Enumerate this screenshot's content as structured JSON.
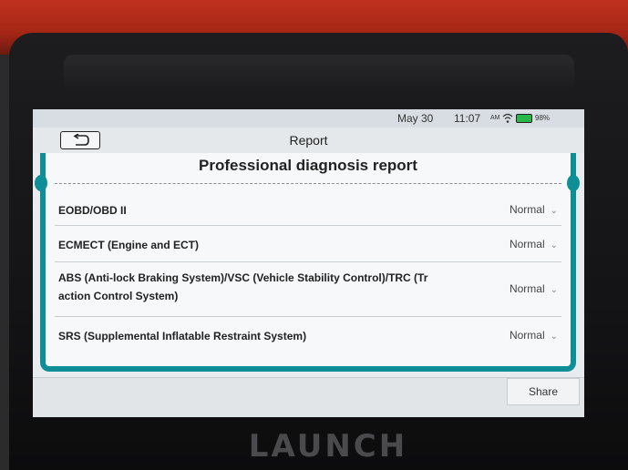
{
  "status_bar": {
    "date": "May 30",
    "time": "11:07",
    "ampm": "AM",
    "battery": "98%"
  },
  "header": {
    "title": "Report",
    "back_icon": "back-arrow-icon"
  },
  "report": {
    "heading": "Professional diagnosis report",
    "rows": [
      {
        "label": "EOBD/OBD II",
        "status": "Normal"
      },
      {
        "label": "ECMECT (Engine and ECT)",
        "status": "Normal"
      },
      {
        "label": "ABS (Anti-lock Braking System)/VSC (Vehicle Stability Control)/TRC (Tr",
        "label_line2": "action Control System)",
        "status": "Normal"
      },
      {
        "label": "SRS (Supplemental Inflatable Restraint System)",
        "status": "Normal"
      }
    ]
  },
  "footer": {
    "share_label": "Share"
  },
  "device": {
    "brand": "LAUNCH"
  },
  "colors": {
    "accent": "#0e8f97",
    "battery": "#28b84a"
  }
}
